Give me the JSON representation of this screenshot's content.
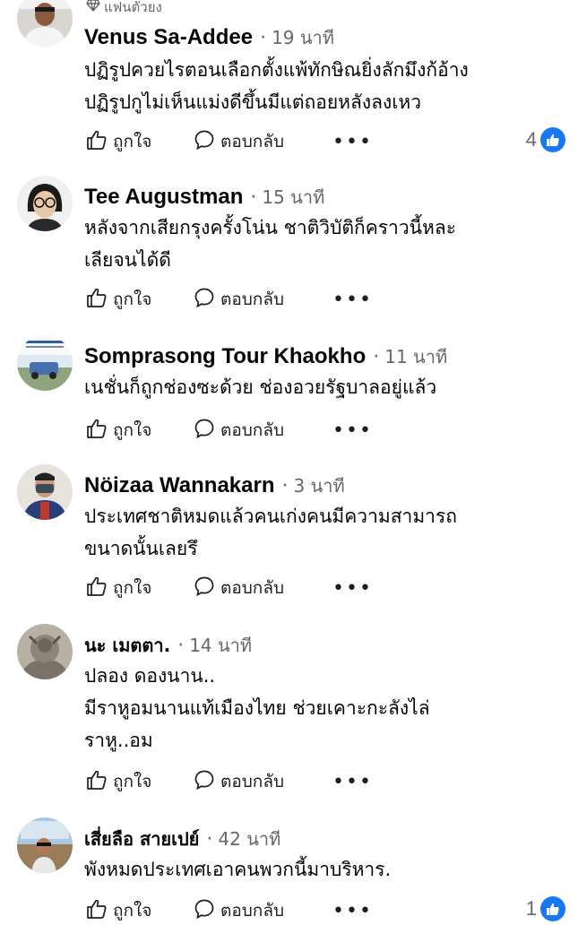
{
  "labels": {
    "like": "ถูกใจ",
    "reply": "ตอบกลับ",
    "more": "•••",
    "dot": "·"
  },
  "comments": [
    {
      "badge": "แฟนตัวยง",
      "author": "Venus Sa-Addee",
      "time": "19 นาที",
      "text": "ปฏิรูปควยไรตอนเลือกตั้งแพ้ทักษิณยิ่งลักมึงก้อ้าง\nปฏิรูปกูไม่เห็นแม่งดีขึ้นมีแต่ถอยหลังลงเหว",
      "reactions": "4"
    },
    {
      "author": "Tee Augustman",
      "time": "15 นาที",
      "text": "หลังจากเสียกรุงครั้งโน่น ชาติวิบัติก็คราวนี้หละ\nเลียจนได้ดี"
    },
    {
      "author": "Somprasong Tour Khaokho",
      "time": "11 นาที",
      "text": "เนชั่นก็ถูกช่องซะด้วย ช่องอวยรัฐบาลอยู่แล้ว"
    },
    {
      "author": "Nöizaa Wannakarn",
      "time": "3 นาที",
      "text": "ประเทศชาติหมดแล้วคนเก่งคนมีความสามารถ\nขนาดนั้นเลยรึ"
    },
    {
      "author": "นะ เมตตา.",
      "time": "14 นาที",
      "text": "ปลอง  ดองนาน..\nมีราหูอมนานแท้เมืองไทย  ช่วยเคาะกะลังไล่\nราหู..อม"
    },
    {
      "author": "เสี่ยลือ สายเปย์",
      "time": "42 นาที",
      "text": "พังหมดประเทศเอาคนพวกนี้มาบริหาร.",
      "reactions": "1"
    }
  ],
  "colors": {
    "text": "#050505",
    "meta": "#65676b",
    "like_blue": "#1877f2"
  }
}
